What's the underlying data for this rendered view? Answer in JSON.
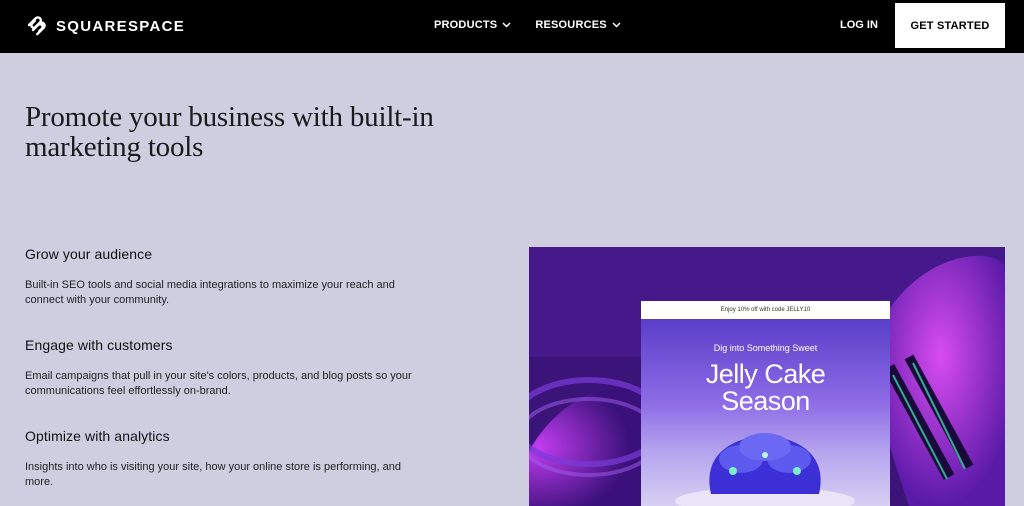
{
  "brand": {
    "name": "SQUARESPACE"
  },
  "nav": {
    "items": [
      {
        "label": "PRODUCTS"
      },
      {
        "label": "RESOURCES"
      }
    ],
    "login_label": "LOG IN",
    "cta_label": "GET STARTED"
  },
  "hero": {
    "headline": "Promote your business with built-in marketing tools"
  },
  "features": [
    {
      "title": "Grow your audience",
      "body": "Built-in SEO tools and social media integrations to maximize your reach and connect with your community."
    },
    {
      "title": "Engage with customers",
      "body": "Email campaigns that pull in your site's colors, products, and blog posts so your communications feel effortlessly on-brand."
    },
    {
      "title": "Optimize with analytics",
      "body": "Insights into who is visiting your site, how your online store is performing, and more."
    }
  ],
  "promo_card": {
    "banner": "Enjoy 10% off with code JELLY10",
    "subtitle": "Dig into Something Sweet",
    "title_line1": "Jelly Cake",
    "title_line2": "Season"
  },
  "colors": {
    "nav_bg": "#000000",
    "page_bg": "#cfcde0",
    "cta_bg": "#ffffff"
  }
}
